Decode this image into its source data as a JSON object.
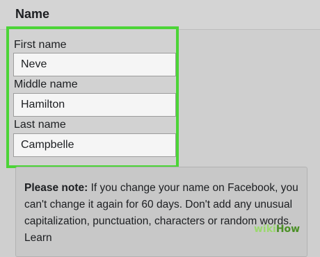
{
  "section_title": "Name",
  "fields": {
    "first": {
      "label": "First name",
      "value": "Neve"
    },
    "middle": {
      "label": "Middle name",
      "value": "Hamilton"
    },
    "last": {
      "label": "Last name",
      "value": "Campbelle"
    }
  },
  "note": {
    "bold": "Please note:",
    "text": " If you change your name on Facebook, you can't change it again for 60 days. Don't add any unusual capitalization, punctuation, characters or random words. Learn"
  },
  "watermark": {
    "prefix": "wiki",
    "suffix": "How"
  },
  "colors": {
    "highlight": "#4cd437"
  }
}
